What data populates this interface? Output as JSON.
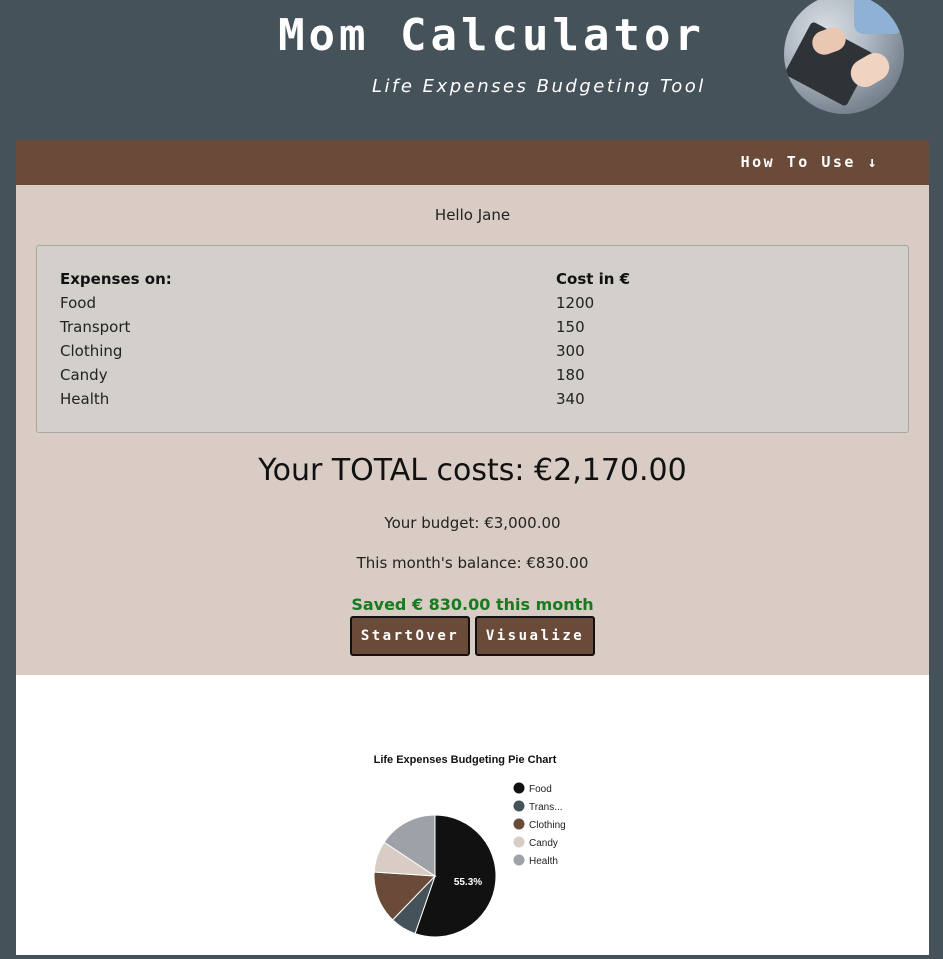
{
  "header": {
    "title": "Mom Calculator",
    "subtitle": "Life Expenses Budgeting Tool",
    "avatar_icon": "hands-on-laptop-photo"
  },
  "nav": {
    "how_to_use": "How To Use ↓"
  },
  "main": {
    "greeting": "Hello Jane",
    "table": {
      "headers": [
        "Expenses on:",
        "Cost in €"
      ],
      "rows": [
        {
          "label": "Food",
          "cost": "1200"
        },
        {
          "label": "Transport",
          "cost": "150"
        },
        {
          "label": "Clothing",
          "cost": "300"
        },
        {
          "label": "Candy",
          "cost": "180"
        },
        {
          "label": "Health",
          "cost": "340"
        }
      ]
    },
    "total": "Your TOTAL costs: €2,170.00",
    "budget": "Your budget: €3,000.00",
    "balance": "This month's balance: €830.00",
    "saved": "Saved € 830.00 this month",
    "buttons": {
      "start_over": "StartOver",
      "visualize": "Visualize"
    }
  },
  "colors": {
    "background": "#465259",
    "brown": "#6a4a38",
    "panel": "#d8ccc4",
    "saved_green": "#177a1e"
  },
  "chart_data": {
    "type": "pie",
    "title": "Life Expenses Budgeting Pie Chart",
    "categories": [
      "Food",
      "Trans...",
      "Clothing",
      "Candy",
      "Health"
    ],
    "values": [
      1200,
      150,
      300,
      180,
      340
    ],
    "colors": [
      "#111111",
      "#465259",
      "#6a4a38",
      "#d8ccc4",
      "#9ea1a7"
    ],
    "slice_label": "55.3%",
    "legend_position": "right"
  }
}
